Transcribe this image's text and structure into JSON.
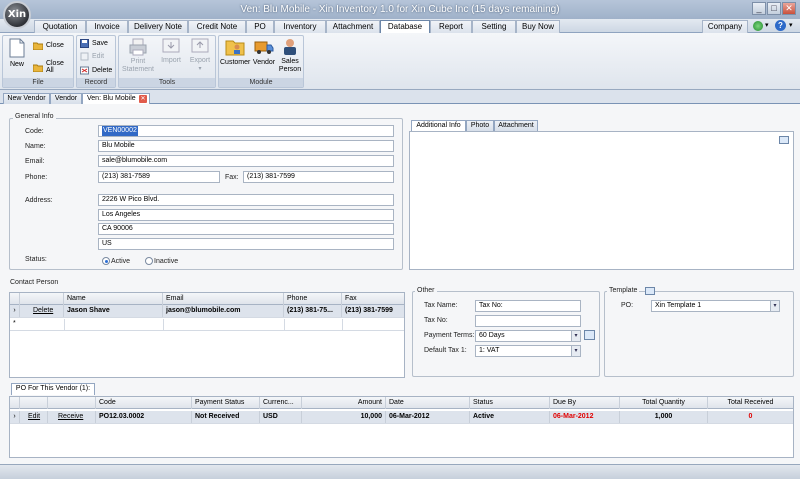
{
  "window": {
    "title": "Ven: Blu Mobile - Xin Inventory 1.0 for Xin Cube Inc (15 days remaining)",
    "logo_text": "Xin"
  },
  "menu": {
    "tabs": [
      "Quotation",
      "Invoice",
      "Delivery Note",
      "Credit Note",
      "PO",
      "Inventory",
      "Attachment",
      "Database",
      "Report",
      "Setting",
      "Buy Now"
    ],
    "active": "Database",
    "company": "Company"
  },
  "ribbon": {
    "file": {
      "new": "New",
      "close": "Close",
      "close_all": "Close All",
      "label": "File"
    },
    "record": {
      "save": "Save",
      "edit": "Edit",
      "delete": "Delete",
      "label": "Record"
    },
    "tools": {
      "print": "Print Statement",
      "import": "Import",
      "export": "Export",
      "label": "Tools"
    },
    "module": {
      "customer": "Customer",
      "vendor": "Vendor",
      "sales_person": "Sales Person",
      "label": "Module"
    }
  },
  "doc_tabs": [
    "New Vendor",
    "Vendor",
    "Ven: Blu Mobile"
  ],
  "general": {
    "legend": "General Info",
    "code_label": "Code:",
    "code": "VEN00002",
    "name_label": "Name:",
    "name": "Blu Mobile",
    "email_label": "Email:",
    "email": "sale@blumobile.com",
    "phone_label": "Phone:",
    "phone": "(213) 381-7589",
    "fax_label": "Fax:",
    "fax": "(213) 381-7599",
    "address_label": "Address:",
    "address": [
      "2226 W Pico Blvd.",
      "Los Angeles",
      "CA 90006",
      "US"
    ],
    "status_label": "Status:",
    "active": "Active",
    "inactive": "Inactive"
  },
  "info_tabs": [
    "Additional Info",
    "Photo",
    "Attachment"
  ],
  "contact": {
    "legend": "Contact Person",
    "columns": [
      "Name",
      "Email",
      "Phone",
      "Fax"
    ],
    "row": {
      "action": "Delete",
      "name": "Jason Shave",
      "email": "jason@blumobile.com",
      "phone": "(213) 381-75...",
      "fax": "(213) 381-7599"
    }
  },
  "other": {
    "legend": "Other",
    "tax_name_label": "Tax Name:",
    "tax_name": "Tax No:",
    "tax_no_label": "Tax No:",
    "tax_no": "",
    "payment_label": "Payment Terms:",
    "payment": "60 Days",
    "default_tax_label": "Default Tax 1:",
    "default_tax": "1: VAT"
  },
  "template": {
    "legend": "Template",
    "po_label": "PO:",
    "po": "Xin Template 1"
  },
  "po_section": {
    "tab": "PO For This Vendor (1):",
    "columns": [
      "Code",
      "Payment Status",
      "Currenc...",
      "Amount",
      "Date",
      "Status",
      "Due By",
      "Total Quantity",
      "Total Received"
    ],
    "row": {
      "edit": "Edit",
      "receive": "Receive",
      "code": "PO12.03.0002",
      "payment_status": "Not Received",
      "currency": "USD",
      "amount": "10,000",
      "date": "06-Mar-2012",
      "status": "Active",
      "due_by": "06-Mar-2012",
      "total_quantity": "1,000",
      "total_received": "0"
    }
  },
  "colors": {
    "accent": "#3169c6",
    "overdue": "#e00000",
    "titlebar": "#9fb1c9"
  }
}
